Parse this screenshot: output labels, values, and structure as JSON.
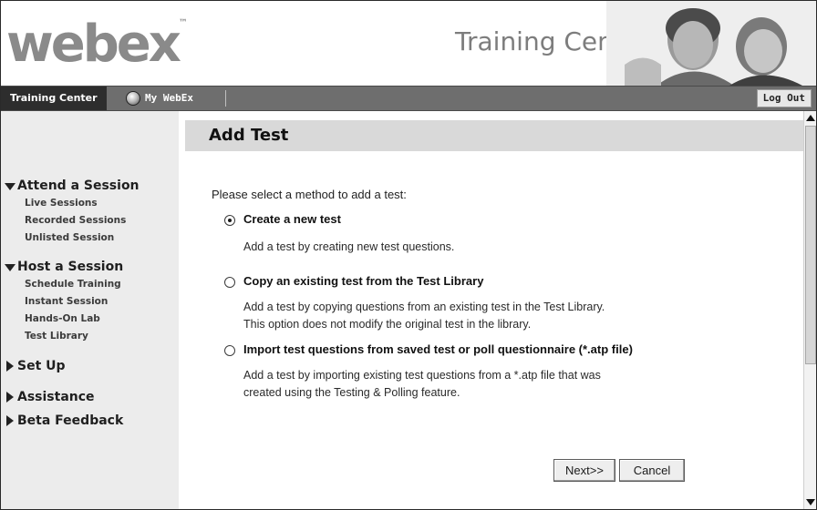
{
  "header": {
    "logo": "webex",
    "logo_tm": "™",
    "product_title": "Training Center"
  },
  "navbar": {
    "active_tab": "Training Center",
    "tab_mywebex": "My WebEx",
    "logout": "Log Out"
  },
  "sidebar": {
    "sections": [
      {
        "label": "Attend a Session",
        "expanded": true,
        "items": [
          "Live Sessions",
          "Recorded Sessions",
          "Unlisted Session"
        ]
      },
      {
        "label": "Host a Session",
        "expanded": true,
        "items": [
          "Schedule Training",
          "Instant Session",
          "Hands-On Lab",
          "Test Library"
        ]
      },
      {
        "label": "Set Up",
        "expanded": false,
        "items": []
      },
      {
        "label": "Assistance",
        "expanded": false,
        "items": []
      },
      {
        "label": "Beta Feedback",
        "expanded": false,
        "items": []
      }
    ]
  },
  "main": {
    "title": "Add Test",
    "prompt": "Please select a method to add a test:",
    "options": [
      {
        "label": "Create a new test",
        "selected": true,
        "desc": [
          "Add a test by creating new test questions."
        ]
      },
      {
        "label": "Copy an existing test from the Test Library",
        "selected": false,
        "desc": [
          "Add a test by copying questions from an existing test in the Test Library.",
          "This option does not modify the original test in the library."
        ]
      },
      {
        "label": "Import test questions from saved test or poll questionnaire (*.atp file)",
        "selected": false,
        "desc": [
          "Add a test by importing existing test questions from a *.atp file that was",
          "created using the Testing & Polling feature."
        ]
      }
    ],
    "next_button": "Next>>",
    "cancel_button": "Cancel"
  },
  "colors": {
    "navbar": "#6e6e6e",
    "sidebar": "#ececec",
    "title_bar": "#d9d9d9"
  }
}
